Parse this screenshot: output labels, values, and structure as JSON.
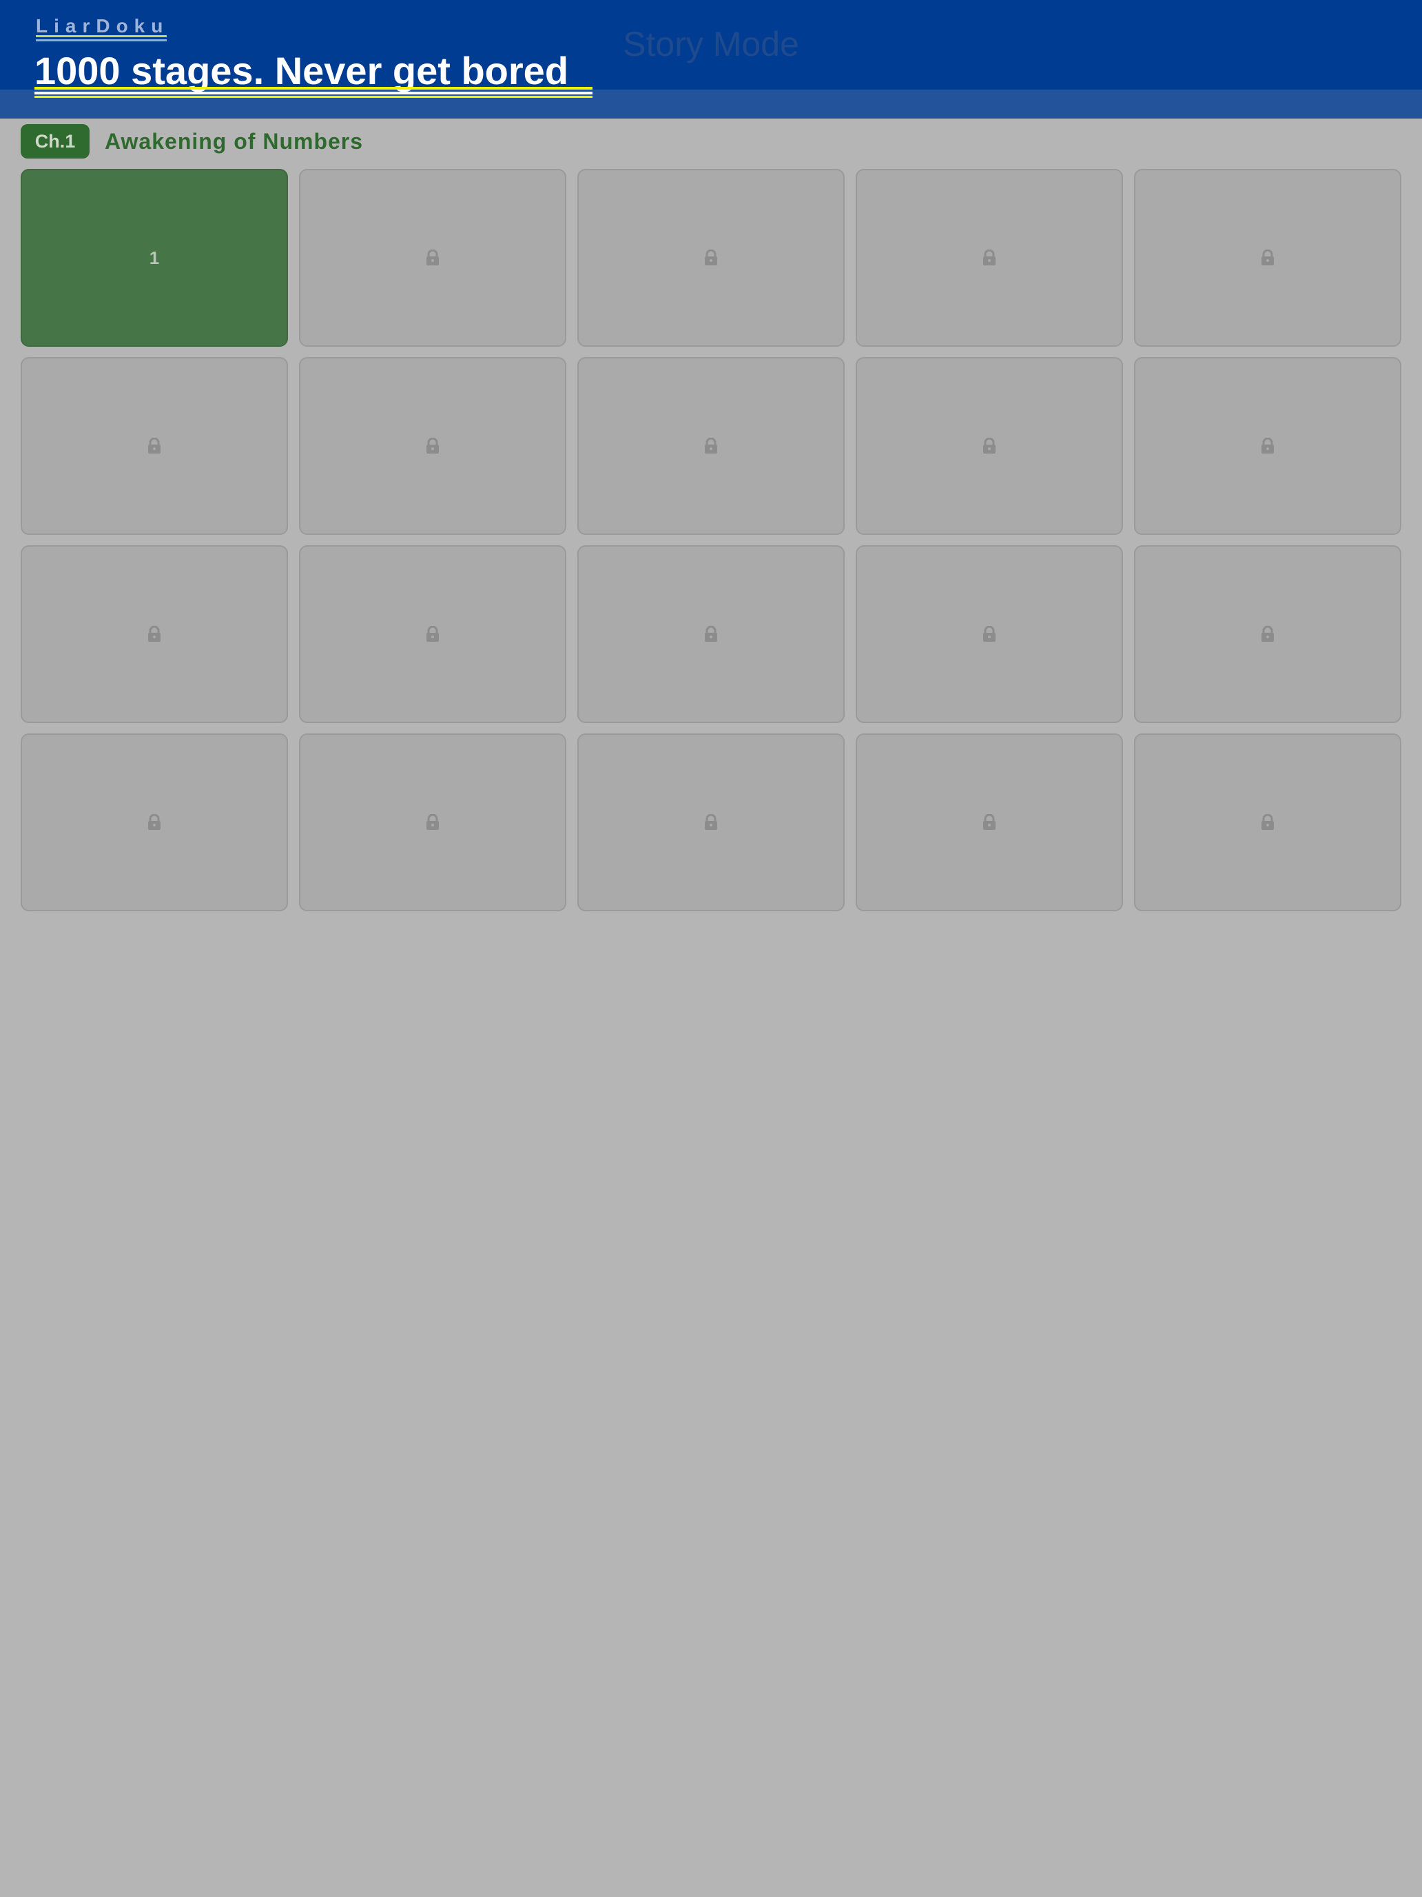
{
  "header": {
    "brand": "LiarDoku",
    "headline": "1000 stages. Never get bored",
    "screen_title": "Story Mode"
  },
  "chapter": {
    "badge": "Ch.1",
    "title": "Awakening of Numbers"
  },
  "stages": [
    {
      "label": "1",
      "locked": false
    },
    {
      "label": "",
      "locked": true
    },
    {
      "label": "",
      "locked": true
    },
    {
      "label": "",
      "locked": true
    },
    {
      "label": "",
      "locked": true
    },
    {
      "label": "",
      "locked": true
    },
    {
      "label": "",
      "locked": true
    },
    {
      "label": "",
      "locked": true
    },
    {
      "label": "",
      "locked": true
    },
    {
      "label": "",
      "locked": true
    },
    {
      "label": "",
      "locked": true
    },
    {
      "label": "",
      "locked": true
    },
    {
      "label": "",
      "locked": true
    },
    {
      "label": "",
      "locked": true
    },
    {
      "label": "",
      "locked": true
    },
    {
      "label": "",
      "locked": true
    },
    {
      "label": "",
      "locked": true
    },
    {
      "label": "",
      "locked": true
    },
    {
      "label": "",
      "locked": true
    },
    {
      "label": "",
      "locked": true
    }
  ],
  "icons": {
    "locked_stage": "lock-icon"
  },
  "colors": {
    "header_bg": "#003d92",
    "accent_green": "#2f6a2f",
    "unlocked_stage": "#467547",
    "locked_stage": "#aaaaaa",
    "overlay_bg": "#b5b5b5",
    "headline_underline": "#f1f200"
  }
}
